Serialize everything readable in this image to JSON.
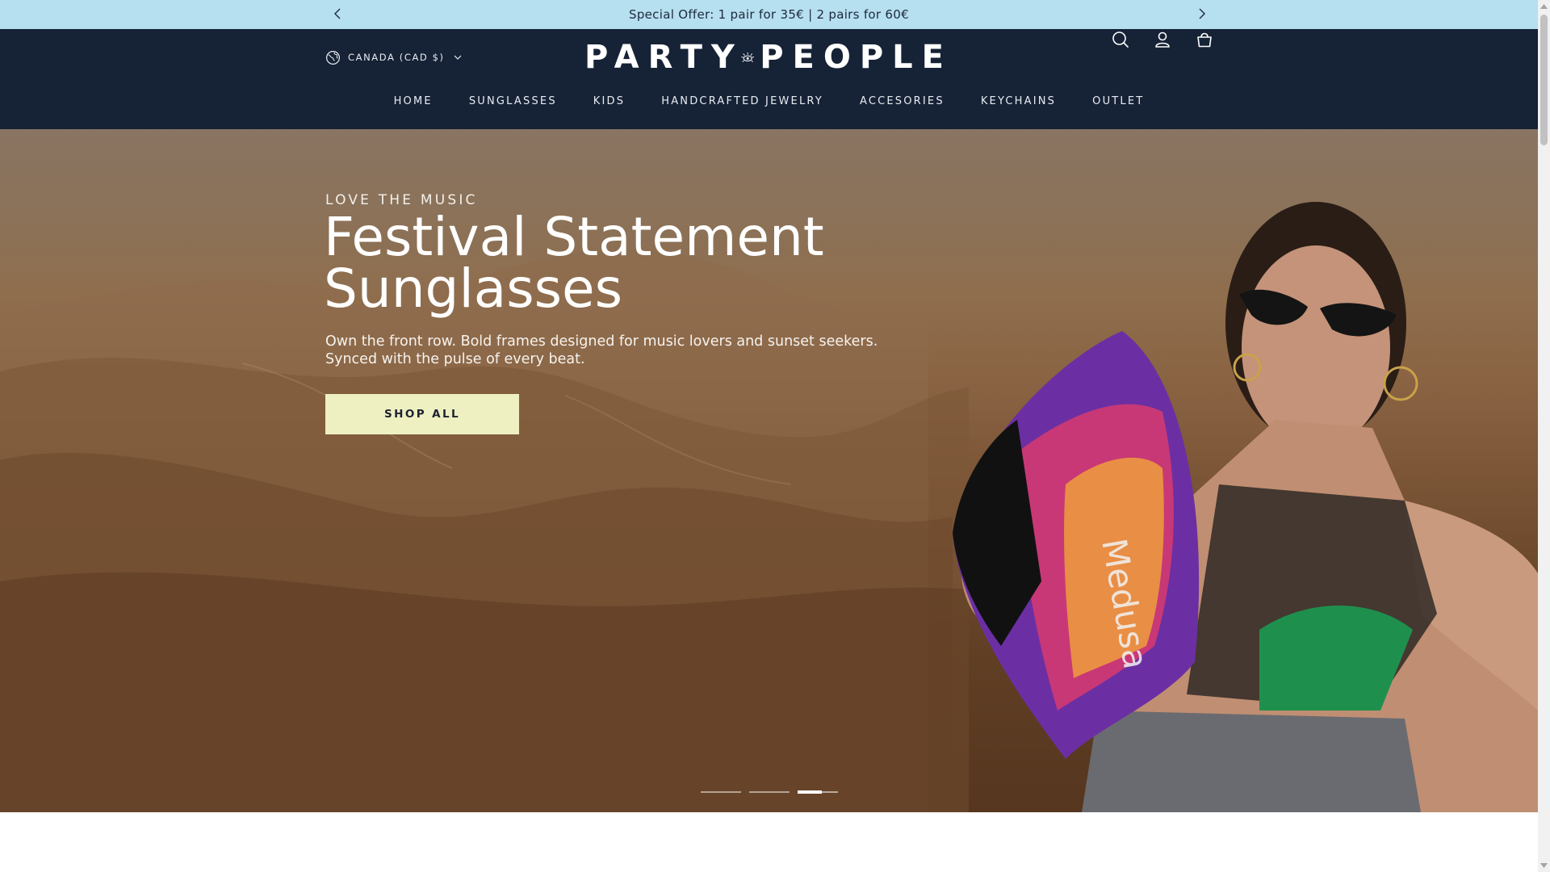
{
  "announcement": {
    "message": "Special Offer: 1 pair for 35€ | 2 pairs for 60€",
    "prev_icon": "chevron-left-icon",
    "next_icon": "chevron-right-icon"
  },
  "header": {
    "locale_label": "CANADA (CAD $)",
    "locale_icon": "globe-icon",
    "logo_left": "PARTY",
    "logo_right": "PEOPLE",
    "icons": [
      "search-icon",
      "account-icon",
      "cart-icon"
    ],
    "nav": [
      {
        "label": "HOME"
      },
      {
        "label": "SUNGLASSES"
      },
      {
        "label": "KIDS"
      },
      {
        "label": "HANDCRAFTED JEWELRY"
      },
      {
        "label": "ACCESORIES"
      },
      {
        "label": "KEYCHAINS"
      },
      {
        "label": "OUTLET"
      }
    ]
  },
  "hero": {
    "kicker": "LOVE THE MUSIC",
    "title_line1": "Festival Statement",
    "title_line2": "Sunglasses",
    "desc_line1": "Own the front row. Bold frames designed for music lovers and sunset seekers.",
    "desc_line2": "Synced with the pulse of every beat.",
    "cta_label": "SHOP ALL",
    "slides_total": 3,
    "active_slide": 3
  },
  "colors": {
    "announcement_bg": "#b6dff0",
    "header_bg": "#162236",
    "cta_bg": "#eef0c1"
  }
}
